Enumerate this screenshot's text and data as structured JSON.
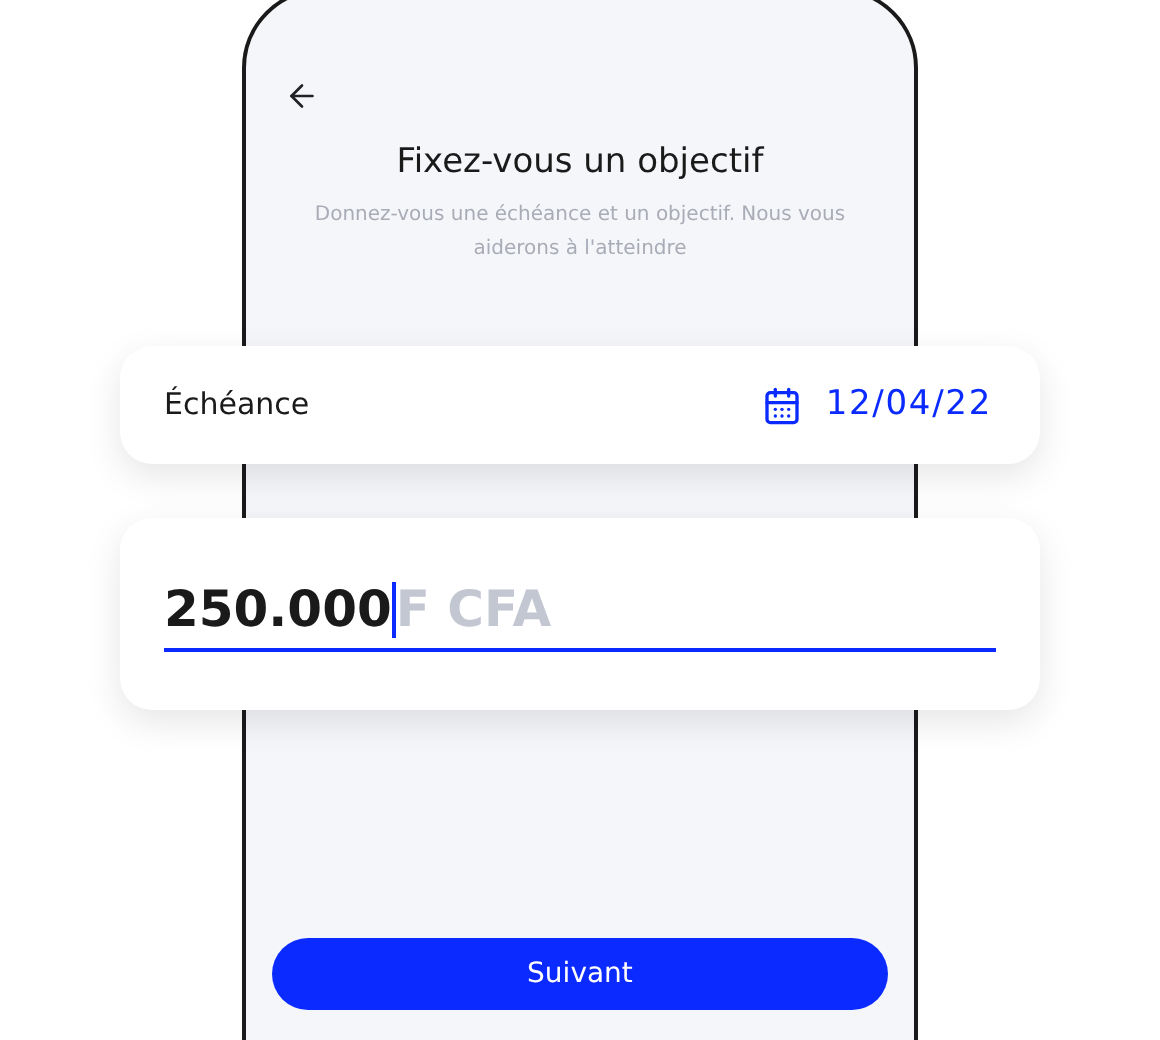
{
  "header": {
    "title": "Fixez-vous un objectif",
    "subtitle": "Donnez-vous une échéance et un objectif. Nous vous aiderons à l'atteindre"
  },
  "deadline": {
    "label": "Échéance",
    "value": "12/04/22"
  },
  "amount": {
    "value": "250.000",
    "unit": "F CFA",
    "focused": true
  },
  "next_button": {
    "label": "Suivant"
  }
}
